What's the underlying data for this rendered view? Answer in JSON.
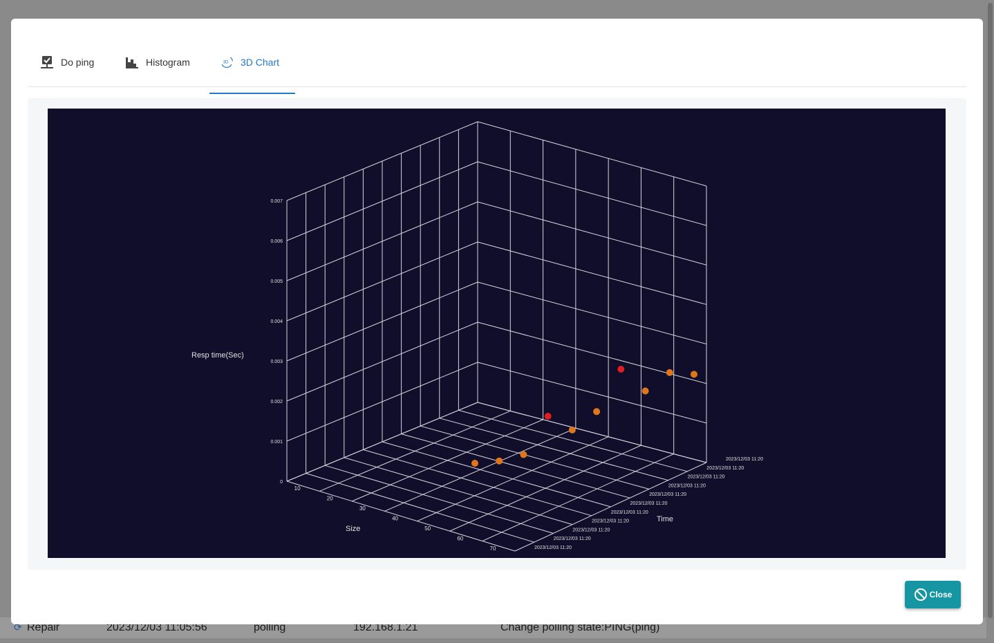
{
  "background": {
    "row": {
      "type": "Repair",
      "time": "2023/12/03 11:05:56",
      "subsystem": "polling",
      "ip": "192.168.1.21",
      "message": "Change polling state:PING(ping)"
    }
  },
  "tabs": [
    {
      "label": "Do ping",
      "icon": "ping-icon",
      "active": false
    },
    {
      "label": "Histogram",
      "icon": "histogram-icon",
      "active": false
    },
    {
      "label": "3D Chart",
      "icon": "3d-rotate-icon",
      "active": true
    }
  ],
  "tab_icon_3d_text": "3D",
  "close_button": {
    "label": "Close",
    "icon": "ban-icon"
  },
  "colors": {
    "accent": "#1f78c8",
    "chart_bg": "#110e2b",
    "close_bg": "#1696a3",
    "point_orange": "#e0761c",
    "point_red": "#e01e1e"
  },
  "chart_data": {
    "type": "scatter3d",
    "zlabel": "Resp time(Sec)",
    "xlabel": "Size",
    "ylabel": "Time",
    "z_ticks": [
      "0",
      "0.001",
      "0.002",
      "0.003",
      "0.004",
      "0.005",
      "0.006",
      "0.007"
    ],
    "x_ticks": [
      "10",
      "20",
      "30",
      "40",
      "50",
      "60",
      "70"
    ],
    "y_ticks": [
      "2023/12/03 11:20",
      "2023/12/03 11:20",
      "2023/12/03 11:20",
      "2023/12/03 11:20",
      "2023/12/03 11:20",
      "2023/12/03 11:20",
      "2023/12/03 11:20",
      "2023/12/03 11:20",
      "2023/12/03 11:20",
      "2023/12/03 11:20",
      "2023/12/03 11:20"
    ],
    "points": [
      {
        "value": 0.004,
        "color": "#e0761c"
      },
      {
        "value": 0.004,
        "color": "#e0761c"
      },
      {
        "value": 0.0041,
        "color": "#e0761c"
      },
      {
        "value": 0.005,
        "color": "#e01e1e"
      },
      {
        "value": 0.0046,
        "color": "#e0761c"
      },
      {
        "value": 0.005,
        "color": "#e0761c"
      },
      {
        "value": 0.006,
        "color": "#e01e1e"
      },
      {
        "value": 0.0054,
        "color": "#e0761c"
      },
      {
        "value": 0.0058,
        "color": "#e0761c"
      },
      {
        "value": 0.0057,
        "color": "#e0761c"
      }
    ],
    "grid": true
  }
}
